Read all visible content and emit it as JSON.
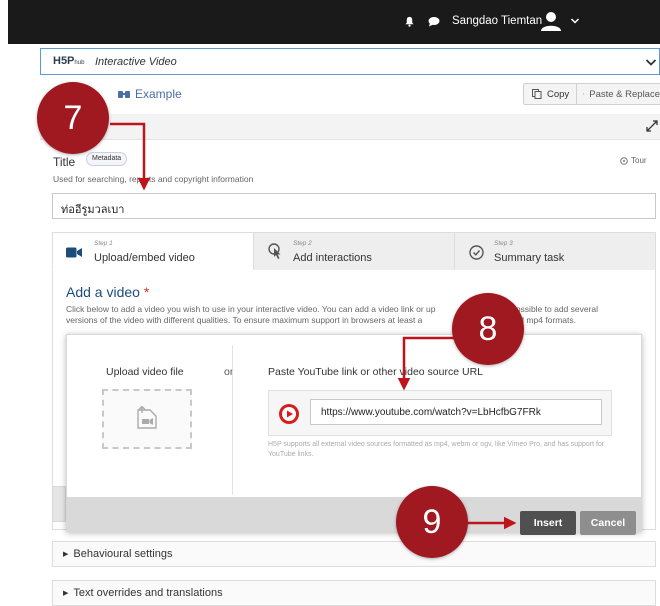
{
  "topbar": {
    "username": "Sangdao Tiemtan"
  },
  "content_type": {
    "logo": "H5P",
    "logo_sub": "hub",
    "name": "Interactive Video"
  },
  "example": {
    "label": "Example"
  },
  "actions": {
    "copy": "Copy",
    "paste": "Paste & Replace"
  },
  "title_field": {
    "label": "Title",
    "metadata": "Metadata",
    "tour": "Tour",
    "description": "Used for searching, reports and copyright information",
    "value": "ท่ออีรูมวลเบา"
  },
  "tabs": [
    {
      "step": "Step 1",
      "name": "Upload/embed video"
    },
    {
      "step": "Step 2",
      "name": "Add interactions"
    },
    {
      "step": "Step 3",
      "name": "Summary task"
    }
  ],
  "add_video": {
    "title": "Add a video",
    "required": "*",
    "description_line1": "Click below to add a video you wish to use in your interactive video. You can add a video link or up",
    "description_line1b": "It is possible to add several",
    "description_line2": "versions of the video with different qualities. To ensure maximum support in browsers at least a",
    "description_line2b": "m and mp4 formats."
  },
  "dialog": {
    "upload_title": "Upload video file",
    "or": "or",
    "paste_title": "Paste YouTube link or other video source URL",
    "url_value": "https://www.youtube.com/watch?v=LbHcfbG7FRk",
    "help_text": "H5P supports all external video sources formatted as mp4, webm or ogv, like Vimeo Pro, and has support for YouTube links.",
    "insert": "Insert",
    "cancel": "Cancel"
  },
  "sections": [
    {
      "label": "Behavioural settings"
    },
    {
      "label": "Text overrides and translations"
    }
  ],
  "callouts": [
    "7",
    "8",
    "9"
  ],
  "colors": {
    "callout": "#a01820",
    "arrow": "#c0141c",
    "accent": "#1d4c7a",
    "insert_btn": "#505050",
    "cancel_btn": "#8e8e8e"
  },
  "icons": [
    "bell-icon",
    "chat-icon",
    "avatar",
    "chevron-down-icon",
    "example-icon",
    "copy-icon",
    "paste-icon",
    "fullscreen-icon",
    "tour-icon",
    "camera-icon",
    "interaction-icon",
    "check-circle-icon",
    "upload-video-icon",
    "youtube-icon"
  ]
}
